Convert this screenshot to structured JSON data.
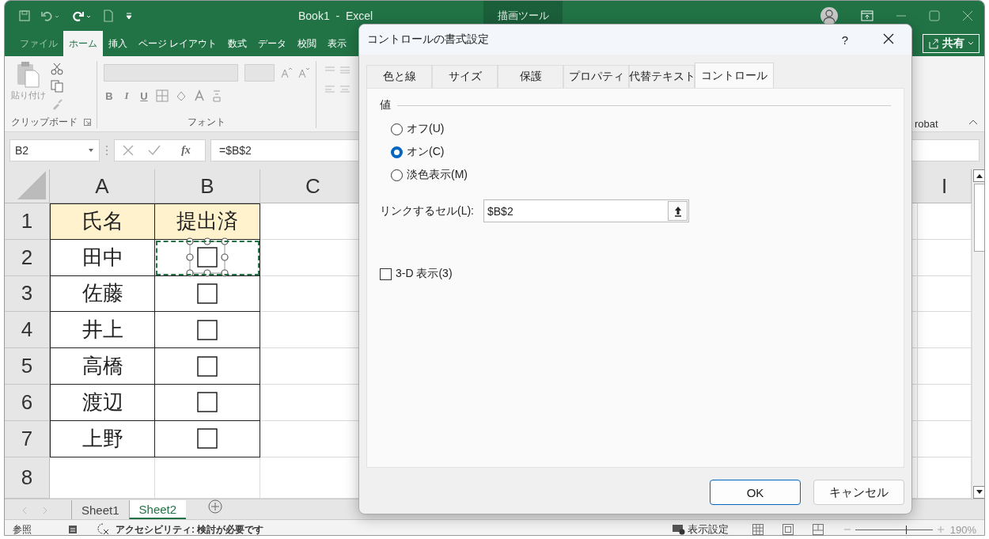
{
  "window": {
    "title": "Book1  -  Excel",
    "context_tab": "描画ツール"
  },
  "ribbon_tabs": [
    {
      "label": "ファイル",
      "selected": false
    },
    {
      "label": "ホーム",
      "selected": true
    },
    {
      "label": "挿入",
      "selected": false
    },
    {
      "label": "ページ レイアウト",
      "selected": false
    },
    {
      "label": "数式",
      "selected": false
    },
    {
      "label": "データ",
      "selected": false
    },
    {
      "label": "校閲",
      "selected": false
    },
    {
      "label": "表示",
      "selected": false
    }
  ],
  "share_button": {
    "label": "共有"
  },
  "ribbon": {
    "paste_label": "貼り付け",
    "groups": [
      "クリップボード",
      "フォント"
    ],
    "font_style_buttons": [
      "B",
      "I",
      "U"
    ],
    "partial_group_label": "robat"
  },
  "formula_bar": {
    "name_box": "B2",
    "fx": "fx",
    "formula": "=$B$2"
  },
  "columns": [
    {
      "label": "A"
    },
    {
      "label": "B"
    },
    {
      "label": "C"
    }
  ],
  "right_column": {
    "label": "I"
  },
  "rows": [
    {
      "number": "1",
      "kind": "header",
      "name": "氏名",
      "status": "提出済"
    },
    {
      "number": "2",
      "kind": "entry",
      "name": "田中",
      "checked": false,
      "selected": true
    },
    {
      "number": "3",
      "kind": "entry",
      "name": "佐藤",
      "checked": false,
      "selected": false
    },
    {
      "number": "4",
      "kind": "entry",
      "name": "井上",
      "checked": false,
      "selected": false
    },
    {
      "number": "5",
      "kind": "entry",
      "name": "高橋",
      "checked": false,
      "selected": false
    },
    {
      "number": "6",
      "kind": "entry",
      "name": "渡辺",
      "checked": false,
      "selected": false
    },
    {
      "number": "7",
      "kind": "entry",
      "name": "上野",
      "checked": false,
      "selected": false
    },
    {
      "number": "8",
      "kind": "empty"
    }
  ],
  "sheet_tabs": [
    {
      "label": "Sheet1",
      "selected": false
    },
    {
      "label": "Sheet2",
      "selected": true
    }
  ],
  "status_bar": {
    "mode": "参照",
    "accessibility": "アクセシビリティ: 検討が必要です",
    "display_settings": "表示設定",
    "zoom": {
      "level": 0.66,
      "label": "190%"
    }
  },
  "dialog": {
    "title": "コントロールの書式設定",
    "help": "?",
    "tabs": [
      {
        "label": "色と線",
        "selected": false
      },
      {
        "label": "サイズ",
        "selected": false
      },
      {
        "label": "保護",
        "selected": false
      },
      {
        "label": "プロパティ",
        "selected": false
      },
      {
        "label": "代替テキスト",
        "selected": false
      },
      {
        "label": "コントロール",
        "selected": true
      }
    ],
    "group_label": "値",
    "options": [
      {
        "label": "オフ(U)",
        "selected": false
      },
      {
        "label": "オン(C)",
        "selected": true
      },
      {
        "label": "淡色表示(M)",
        "selected": false
      }
    ],
    "link_label": "リンクするセル(L):",
    "link_value": "$B$2",
    "three_d": {
      "label": "3-D 表示(3)",
      "checked": false
    },
    "buttons": [
      {
        "label": "OK",
        "default": true
      },
      {
        "label": "キャンセル",
        "default": false
      }
    ]
  }
}
